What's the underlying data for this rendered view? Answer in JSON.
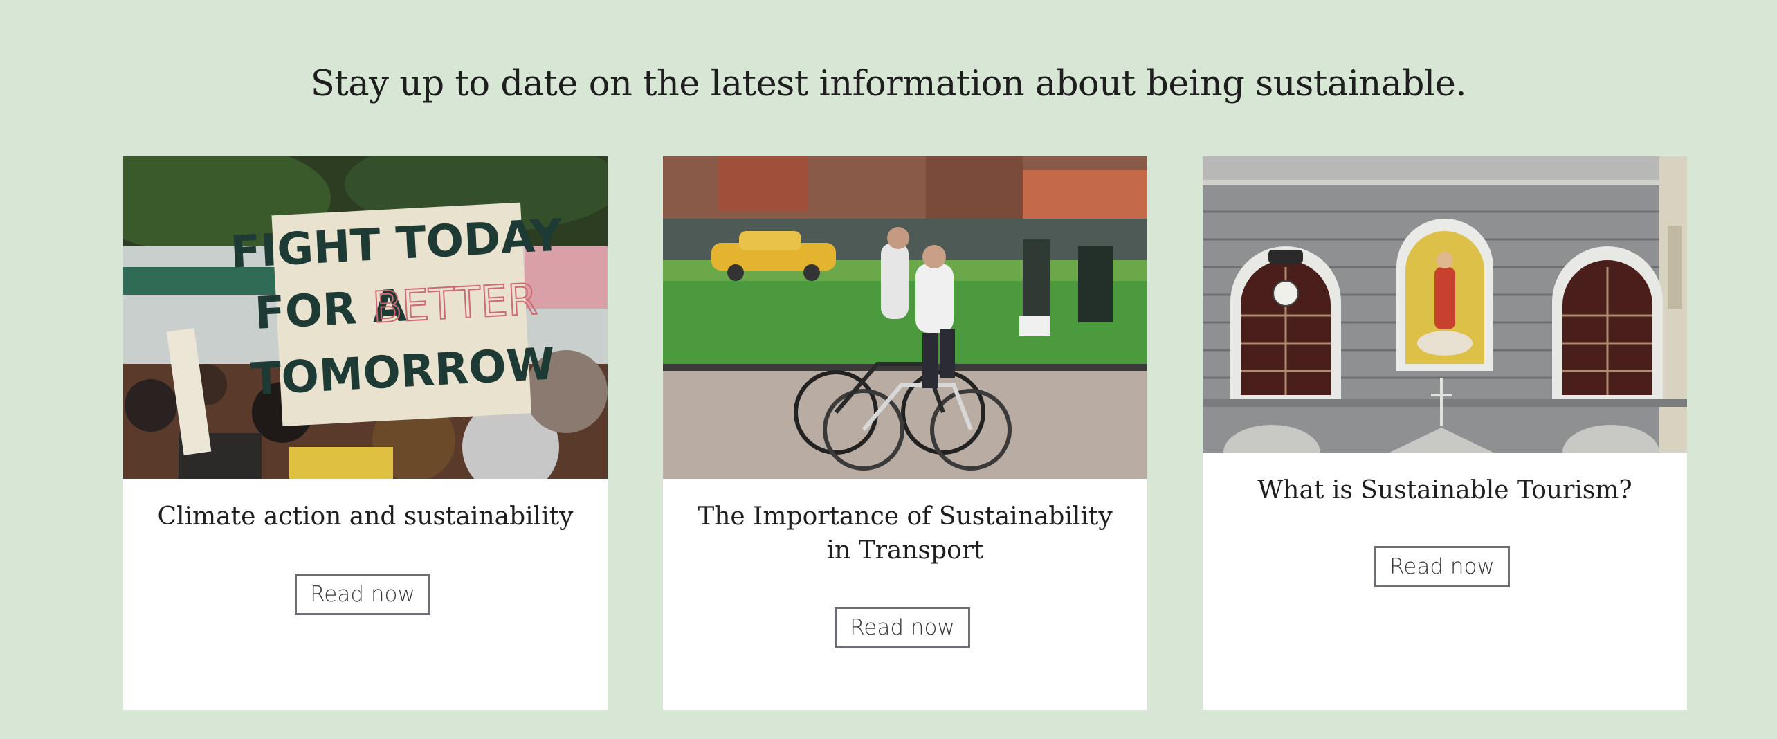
{
  "page": {
    "heading": "Stay up to date on the latest information about being sustainable."
  },
  "cards": [
    {
      "title": "Climate action and sustainability",
      "button_label": "Read now",
      "image_subject": "protest sign reading FIGHT TODAY FOR A BETTER TOMORROW",
      "sign_lines": [
        "FIGHT TODAY",
        "FOR A",
        "BETTER",
        "TOMORROW"
      ]
    },
    {
      "title": "The Importance of Sustainability in Transport",
      "button_label": "Read now",
      "image_subject": "two cyclists riding past a blurred taxi and runners"
    },
    {
      "title": "What is Sustainable Tourism?",
      "button_label": "Read now",
      "image_subject": "stone facade with arched windows, clock and mosaic"
    }
  ],
  "colors": {
    "background": "#d8e7d5",
    "card": "#ffffff",
    "button_border": "#6b6f73",
    "text": "#1e1e1e"
  }
}
